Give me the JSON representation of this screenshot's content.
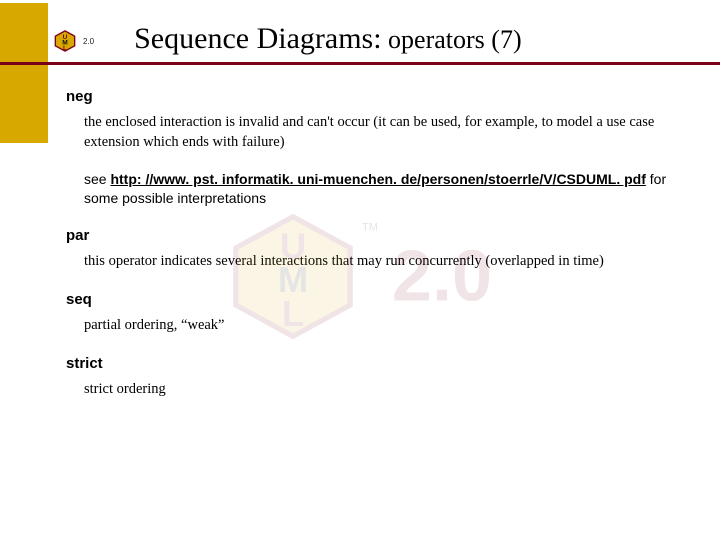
{
  "colors": {
    "accent": "#7a0019",
    "gold": "#d7a900"
  },
  "logo": {
    "version_small": "2.0",
    "watermark_version": "2.0"
  },
  "title": {
    "main": "Sequence Diagrams:",
    "tail": " operators (7)"
  },
  "ops": {
    "neg": {
      "name": "neg",
      "desc": "the enclosed interaction is invalid and can't occur (it can be used, for example, to model a use case extension which ends with failure)",
      "see_pre": "see ",
      "link": "http: //www. pst. informatik. uni-muenchen. de/personen/stoerrle/V/CSDUML. pdf",
      "see_post": " for some possible interpretations"
    },
    "par": {
      "name": "par",
      "desc": "this operator indicates several interactions that may run concurrently (overlapped in time)"
    },
    "seq": {
      "name": "seq",
      "desc": "partial ordering, “weak”"
    },
    "strict": {
      "name": "strict",
      "desc": "strict ordering"
    }
  }
}
